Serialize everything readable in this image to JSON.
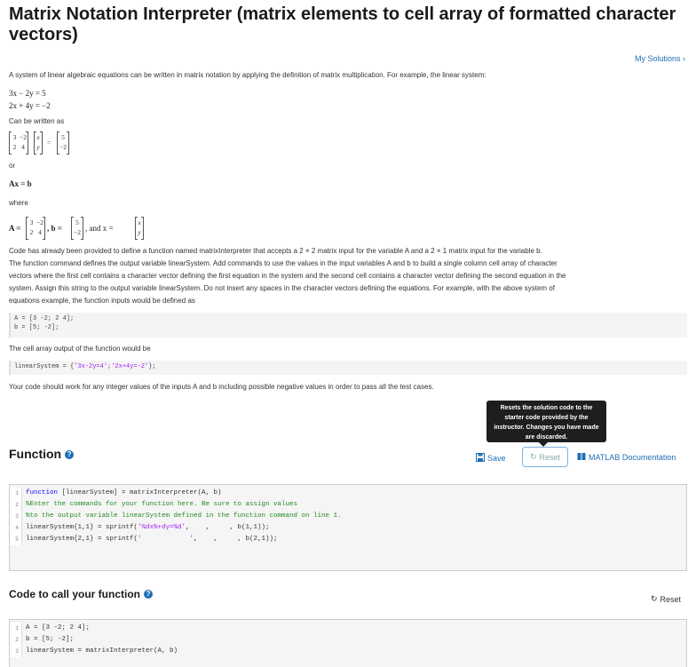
{
  "title": "Matrix Notation Interpreter (matrix elements to cell array of formatted character vectors)",
  "my_solutions": "My Solutions ›",
  "intro": "A system of linear algebraic equations can be written in matrix notation by applying the definition of matrix multiplication. For example, the linear system:",
  "eq1": "3x − 2y = 5",
  "eq2": "2x + 4y = −2",
  "can_be_written": "Can be written as",
  "or": "or",
  "axb": "Ax = b",
  "where": "where",
  "A_label": "A =",
  "b_label": ", b =",
  "and_x": ", and x =",
  "desc1": "Code has already been provided to define a function named matrixInterpreter that accepts a 2 × 2 matrix input for the variable A and a 2 × 1 matrix input for the variable b.",
  "desc2": "The function command defines the output variable linearSystem.  Add commands to use the values in the input variables A and b to build a single column cell array of character",
  "desc3": "vectors where the first cell contains a character vector defining the first equation in the system and the second cell contains a character vector defining the second equation in the",
  "desc4": "system. Assign this string to the output variable linearSystem.  Do not insert any spaces in the character vectors defining the equations. For example, with the above system of",
  "desc5": "equations example, the function inputs would be defined as",
  "ex_line1": "A = [3 -2; 2 4];",
  "ex_line2": "b = [5; -2];",
  "cell_output": "The cell array output of the function would be",
  "output_prefix": "linearSystem = {",
  "output_str": "'3x-2y=4';'2x+4y=-2'",
  "output_suffix": "};",
  "work_note": "Your code should work for any integer values of the inputs A and b including possible negative values in order to pass all the test cases.",
  "tooltip": "Resets the solution code to the starter code provided by the instructor. Changes you have made are discarded.",
  "function_heading": "Function",
  "save_label": "Save",
  "reset_label": "Reset",
  "matlab_doc": "MATLAB Documentation",
  "function_code": [
    {
      "n": "1",
      "parts": [
        {
          "t": "kw",
          "v": "function"
        },
        {
          "t": "",
          "v": " [linearSystem] = matrixInterpreter(A, b)"
        }
      ]
    },
    {
      "n": "2",
      "parts": [
        {
          "t": "cm",
          "v": "%Enter the commands for your function here. Be sure to assign values"
        }
      ]
    },
    {
      "n": "3",
      "parts": [
        {
          "t": "cm",
          "v": "%to the output variable linearSystem defined in the function command on line 1."
        }
      ]
    },
    {
      "n": "4",
      "parts": [
        {
          "t": "",
          "v": "linearSystem{1,1} = sprintf("
        },
        {
          "t": "st",
          "v": "'%dx%+dy=%d'"
        },
        {
          "t": "",
          "v": ",    ,     , b(1,1));"
        }
      ]
    },
    {
      "n": "5",
      "parts": [
        {
          "t": "",
          "v": "linearSystem{2,1} = sprintf("
        },
        {
          "t": "st",
          "v": "'            '"
        },
        {
          "t": "",
          "v": ",    ,     , b(2,1));"
        }
      ]
    }
  ],
  "call_heading": "Code to call your function",
  "call_reset": "Reset",
  "call_code": [
    {
      "n": "1",
      "parts": [
        {
          "t": "",
          "v": "A = [3 -2; 2 4];"
        }
      ]
    },
    {
      "n": "2",
      "parts": [
        {
          "t": "",
          "v": "b = [5; -2];"
        }
      ]
    },
    {
      "n": "3",
      "parts": [
        {
          "t": "",
          "v": "linearSystem = matrixInterpreter(A, b)"
        }
      ]
    }
  ],
  "colors": {
    "link": "#1f6fb5",
    "keyword": "#0e00ff",
    "comment": "#228b22",
    "string": "#a020f0"
  }
}
